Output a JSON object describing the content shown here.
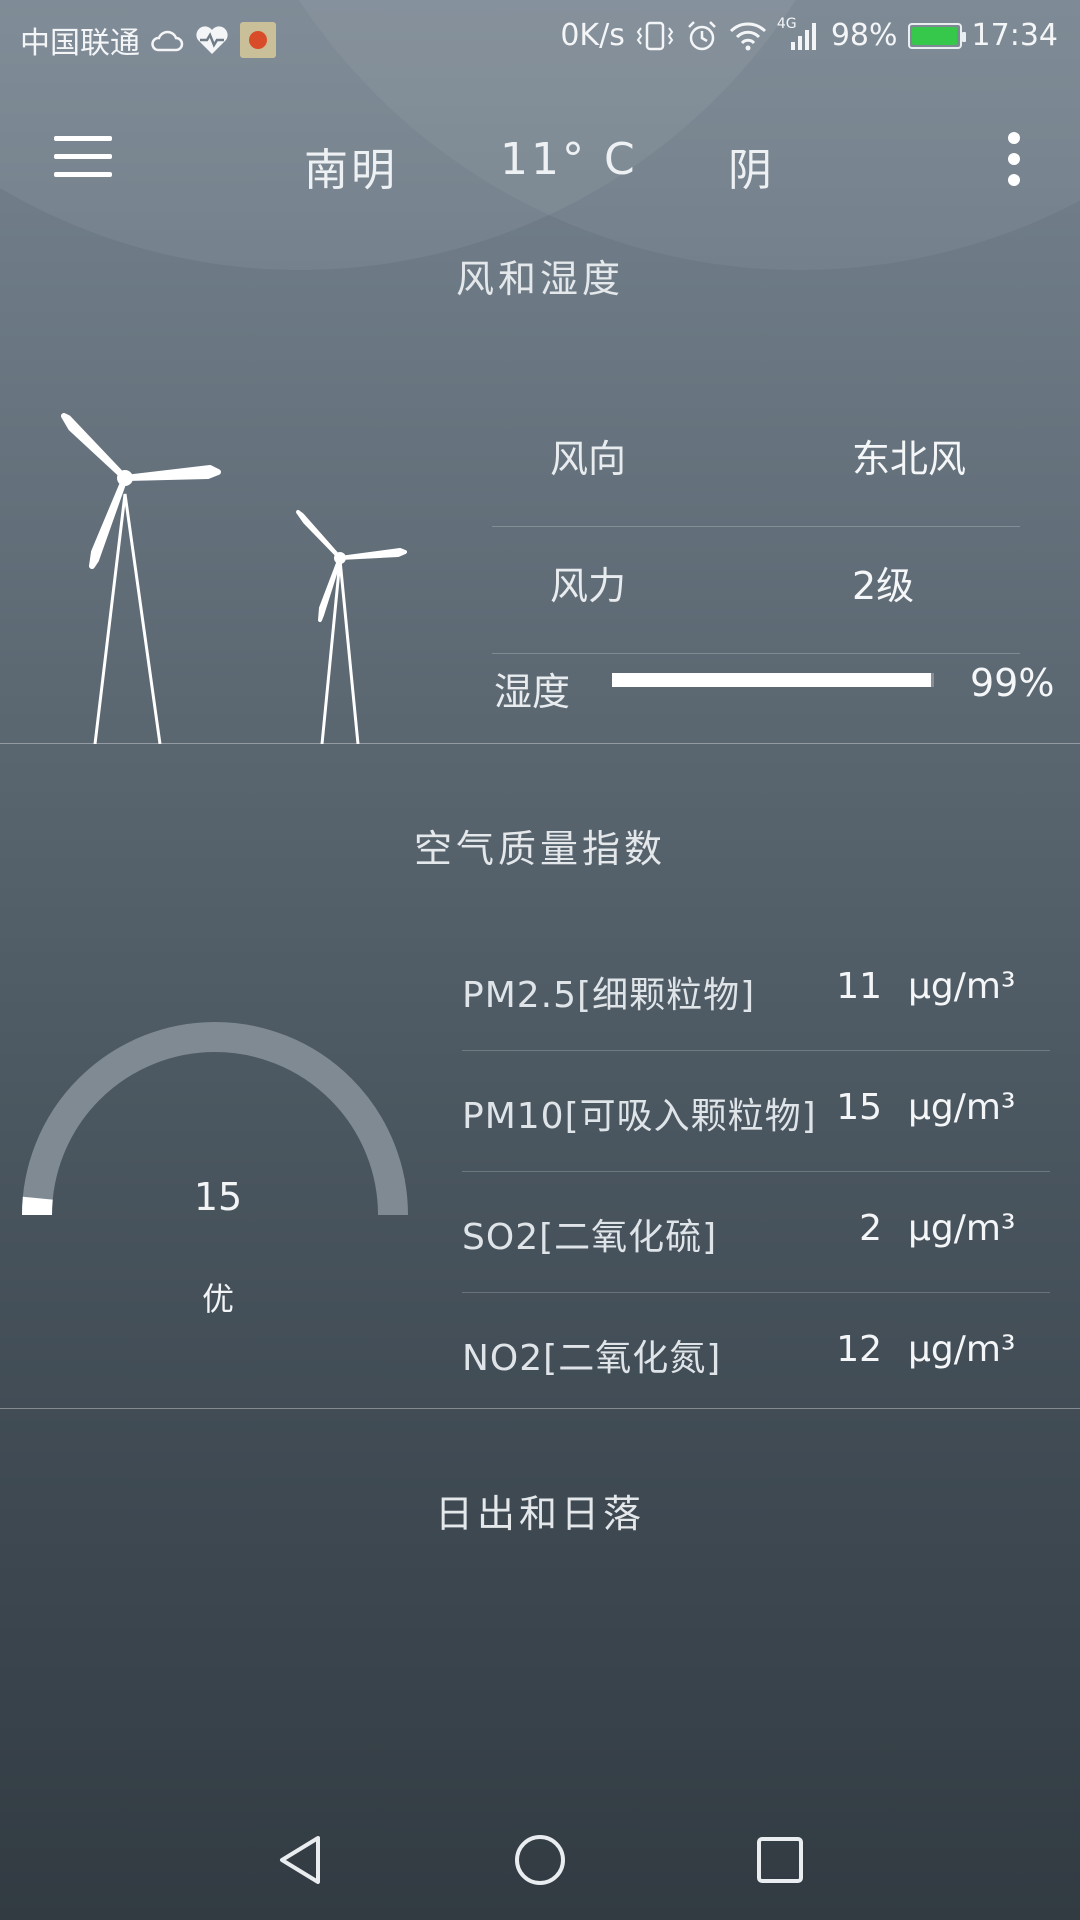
{
  "status_bar": {
    "carrier": "中国联通",
    "net_speed": "0K/s",
    "network_type": "4G",
    "battery_percent": "98%",
    "battery_level": 0.98,
    "battery_color": "#35c84a",
    "time": "17:34",
    "icons": [
      "cloud-icon",
      "health-heart-icon",
      "app-thumbnail-icon",
      "vibrate-icon",
      "alarm-icon",
      "wifi-icon",
      "signal-icon",
      "battery-charging-icon"
    ]
  },
  "header": {
    "city": "南明",
    "temperature": "11° C",
    "weather": "阴",
    "menu_icon": "hamburger-menu-icon",
    "more_icon": "more-vert-icon"
  },
  "wind_section": {
    "title": "风和湿度",
    "rows": [
      {
        "label": "风向",
        "value": "东北风"
      },
      {
        "label": "风力",
        "value": "2级"
      }
    ],
    "humidity": {
      "label": "湿度",
      "value": "99%",
      "level": 0.99
    }
  },
  "air_section": {
    "title": "空气质量指数",
    "aqi": {
      "value": "15",
      "level_text": "优",
      "fraction": 0.03
    },
    "rows": [
      {
        "name": "PM2.5[细颗粒物]",
        "value": "11",
        "unit": "μg/m³"
      },
      {
        "name": "PM10[可吸入颗粒物]",
        "value": "15",
        "unit": "μg/m³"
      },
      {
        "name": "SO2[二氧化硫]",
        "value": "2",
        "unit": "μg/m³"
      },
      {
        "name": "NO2[二氧化氮]",
        "value": "12",
        "unit": "μg/m³"
      }
    ]
  },
  "sun_section": {
    "title": "日出和日落"
  },
  "nav_bar": {
    "icons": [
      "back-icon",
      "home-icon",
      "recents-icon"
    ]
  }
}
